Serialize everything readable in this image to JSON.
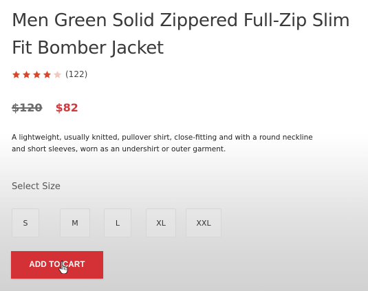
{
  "product": {
    "title": "Men Green Solid Zippered Full-Zip Slim Fit Bomber Jacket",
    "rating": {
      "value": 4,
      "max": 5,
      "review_count": "(122)",
      "filled_color": "#d9472b",
      "empty_color": "#f2c9be"
    },
    "price": {
      "original": "$120",
      "sale": "$82",
      "sale_color": "#cf3a3e"
    },
    "description": "A lightweight, usually knitted, pullover shirt, close-fitting and with a round neckline and short sleeves, worn as an undershirt or outer garment."
  },
  "size_selector": {
    "label": "Select Size",
    "options": [
      "S",
      "M",
      "L",
      "XL",
      "XXL"
    ]
  },
  "actions": {
    "add_to_cart_label": "ADD TO CART",
    "button_color": "#d33136"
  },
  "cursor": {
    "icon": "hand-pointer-icon"
  }
}
